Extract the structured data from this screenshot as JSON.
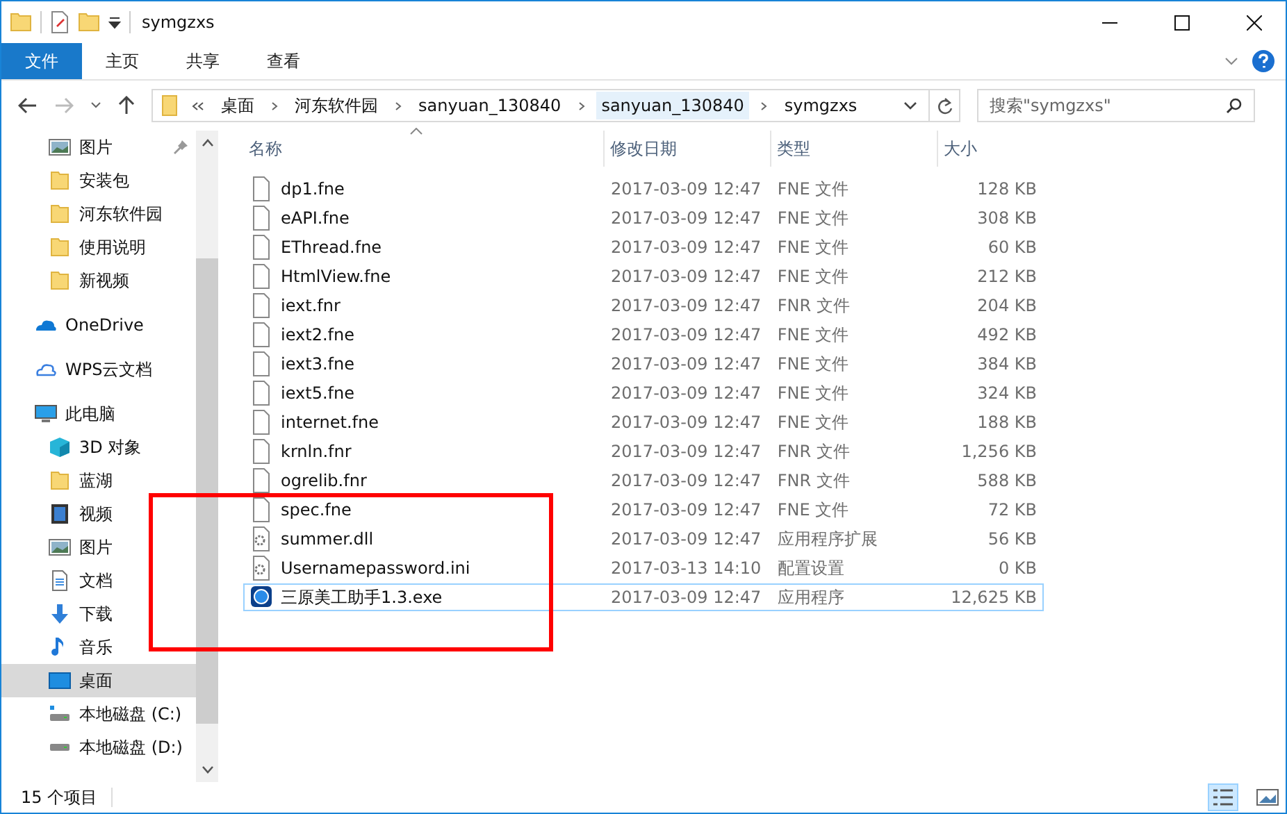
{
  "window": {
    "title": "symgzxs"
  },
  "ribbon_tabs": [
    {
      "label": "文件",
      "kind": "file"
    },
    {
      "label": "主页",
      "kind": "tab"
    },
    {
      "label": "共享",
      "kind": "tab"
    },
    {
      "label": "查看",
      "kind": "tab"
    }
  ],
  "address": {
    "crumbs": [
      "桌面",
      "河东软件园",
      "sanyuan_130840",
      "sanyuan_130840",
      "symgzxs"
    ],
    "search_placeholder": "搜索\"symgzxs\""
  },
  "sidebar": {
    "quick_access": [
      {
        "label": "图片",
        "kind": "pictures",
        "pinned": true,
        "selected": false
      },
      {
        "label": "安装包",
        "kind": "folder",
        "pinned": false,
        "selected": false
      },
      {
        "label": "河东软件园",
        "kind": "folder",
        "pinned": false,
        "selected": false
      },
      {
        "label": "使用说明",
        "kind": "folder",
        "pinned": false,
        "selected": false
      },
      {
        "label": "新视频",
        "kind": "folder",
        "pinned": false,
        "selected": false
      }
    ],
    "items": [
      {
        "label": "OneDrive",
        "kind": "onedrive",
        "selected": false
      },
      {
        "label": "WPS云文档",
        "kind": "cloud",
        "selected": false
      },
      {
        "label": "此电脑",
        "kind": "pc",
        "selected": false,
        "children": [
          {
            "label": "3D 对象",
            "kind": "cube",
            "selected": false
          },
          {
            "label": "蓝湖",
            "kind": "folder",
            "selected": false
          },
          {
            "label": "视频",
            "kind": "video",
            "selected": false
          },
          {
            "label": "图片",
            "kind": "pictures",
            "selected": false
          },
          {
            "label": "文档",
            "kind": "document",
            "selected": false
          },
          {
            "label": "下载",
            "kind": "download",
            "selected": false
          },
          {
            "label": "音乐",
            "kind": "music",
            "selected": false
          },
          {
            "label": "桌面",
            "kind": "desktop",
            "selected": true
          },
          {
            "label": "本地磁盘 (C:)",
            "kind": "system-drive",
            "selected": false
          },
          {
            "label": "本地磁盘 (D:)",
            "kind": "drive",
            "selected": false
          }
        ]
      }
    ]
  },
  "table": {
    "columns": [
      "名称",
      "修改日期",
      "类型",
      "大小"
    ],
    "rows": [
      {
        "name": "dp1.fne",
        "date": "2017-03-09 12:47",
        "type": "FNE 文件",
        "size": "128 KB",
        "kind": "file",
        "selected": false
      },
      {
        "name": "eAPI.fne",
        "date": "2017-03-09 12:47",
        "type": "FNE 文件",
        "size": "308 KB",
        "kind": "file",
        "selected": false
      },
      {
        "name": "EThread.fne",
        "date": "2017-03-09 12:47",
        "type": "FNE 文件",
        "size": "60 KB",
        "kind": "file",
        "selected": false
      },
      {
        "name": "HtmlView.fne",
        "date": "2017-03-09 12:47",
        "type": "FNE 文件",
        "size": "212 KB",
        "kind": "file",
        "selected": false
      },
      {
        "name": "iext.fnr",
        "date": "2017-03-09 12:47",
        "type": "FNR 文件",
        "size": "204 KB",
        "kind": "file",
        "selected": false
      },
      {
        "name": "iext2.fne",
        "date": "2017-03-09 12:47",
        "type": "FNE 文件",
        "size": "492 KB",
        "kind": "file",
        "selected": false
      },
      {
        "name": "iext3.fne",
        "date": "2017-03-09 12:47",
        "type": "FNE 文件",
        "size": "384 KB",
        "kind": "file",
        "selected": false
      },
      {
        "name": "iext5.fne",
        "date": "2017-03-09 12:47",
        "type": "FNE 文件",
        "size": "324 KB",
        "kind": "file",
        "selected": false
      },
      {
        "name": "internet.fne",
        "date": "2017-03-09 12:47",
        "type": "FNE 文件",
        "size": "188 KB",
        "kind": "file",
        "selected": false
      },
      {
        "name": "krnln.fnr",
        "date": "2017-03-09 12:47",
        "type": "FNR 文件",
        "size": "1,256 KB",
        "kind": "file",
        "selected": false
      },
      {
        "name": "ogrelib.fnr",
        "date": "2017-03-09 12:47",
        "type": "FNR 文件",
        "size": "588 KB",
        "kind": "file",
        "selected": false
      },
      {
        "name": "spec.fne",
        "date": "2017-03-09 12:47",
        "type": "FNE 文件",
        "size": "72 KB",
        "kind": "file",
        "selected": false
      },
      {
        "name": "summer.dll",
        "date": "2017-03-09 12:47",
        "type": "应用程序扩展",
        "size": "56 KB",
        "kind": "dll",
        "selected": false
      },
      {
        "name": "Usernamepassword.ini",
        "date": "2017-03-13 14:10",
        "type": "配置设置",
        "size": "0 KB",
        "kind": "ini",
        "selected": false
      },
      {
        "name": "三原美工助手1.3.exe",
        "date": "2017-03-09 12:47",
        "type": "应用程序",
        "size": "12,625 KB",
        "kind": "exe",
        "selected": true
      }
    ]
  },
  "status_bar": {
    "count": "15 个项目",
    "views": [
      {
        "kind": "details",
        "selected": true
      },
      {
        "kind": "large-icons",
        "selected": false
      }
    ]
  }
}
